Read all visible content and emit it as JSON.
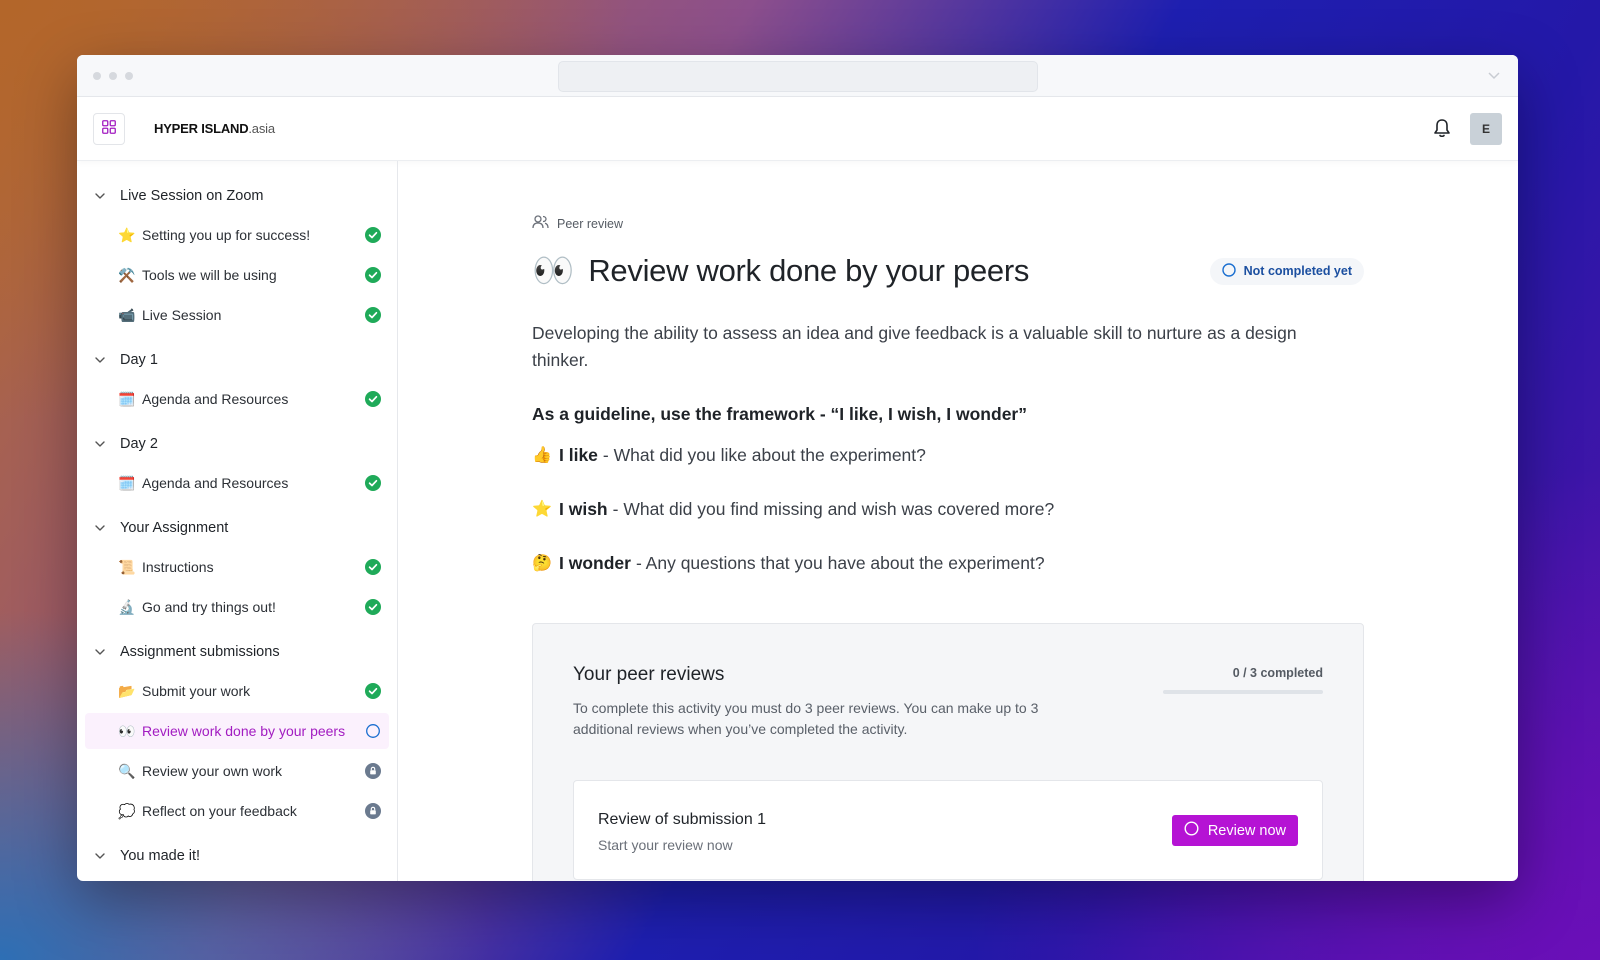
{
  "app": {
    "logo_main": "HYPER ISLAND",
    "logo_suffix": ".asia",
    "avatar_initial": "E"
  },
  "sidebar": {
    "sections": [
      {
        "title": "Live Session on Zoom",
        "items": [
          {
            "emoji": "⭐",
            "label": "Setting you up for success!",
            "status": "completed"
          },
          {
            "emoji": "⚒️",
            "label": "Tools we will be using",
            "status": "completed"
          },
          {
            "emoji": "📹",
            "label": "Live Session",
            "status": "completed"
          }
        ]
      },
      {
        "title": "Day 1",
        "items": [
          {
            "emoji": "🗓️",
            "label": "Agenda and Resources",
            "status": "completed"
          }
        ]
      },
      {
        "title": "Day 2",
        "items": [
          {
            "emoji": "🗓️",
            "label": "Agenda and Resources",
            "status": "completed"
          }
        ]
      },
      {
        "title": "Your Assignment",
        "items": [
          {
            "emoji": "📜",
            "label": "Instructions",
            "status": "completed"
          },
          {
            "emoji": "🔬",
            "label": "Go and try things out!",
            "status": "completed"
          }
        ]
      },
      {
        "title": "Assignment submissions",
        "items": [
          {
            "emoji": "📂",
            "label": "Submit your work",
            "status": "completed"
          },
          {
            "emoji": "👀",
            "label": "Review work done by your peers",
            "status": "in-progress"
          },
          {
            "emoji": "🔍",
            "label": "Review your own work",
            "status": "locked"
          },
          {
            "emoji": "💭",
            "label": "Reflect on your feedback",
            "status": "locked"
          }
        ]
      },
      {
        "title": "You made it!",
        "items": []
      }
    ]
  },
  "main": {
    "breadcrumb": "Peer review",
    "title_emoji": "👀",
    "title": "Review work done by your peers",
    "status_badge": "Not completed yet",
    "intro": "Developing the ability to assess an idea and give feedback is a valuable skill to nurture as a design thinker.",
    "guideline": "As a guideline, use the framework - “I like,  I wish, I wonder”",
    "framework": [
      {
        "emoji": "👍",
        "term": "I like",
        "text": "- What did you like about the experiment?"
      },
      {
        "emoji": "⭐",
        "term": "I wish",
        "text": "- What did you find missing and wish was covered more?"
      },
      {
        "emoji": "🤔",
        "term": "I wonder",
        "text": "- Any questions that you have about the experiment?"
      }
    ],
    "peer_reviews": {
      "title": "Your peer reviews",
      "description": "To complete this activity you must do 3 peer reviews. You can make up to 3 additional reviews when you’ve completed the activity.",
      "progress_text": "0 / 3 completed",
      "progress_fraction": 0,
      "submissions": [
        {
          "title": "Review of submission 1",
          "subtitle": "Start your review now",
          "button": "Review now"
        }
      ]
    }
  },
  "colors": {
    "accent": "#b513d4",
    "completed": "#1faa59",
    "in_progress": "#1b6fd0",
    "locked": "#6b7a8f"
  }
}
